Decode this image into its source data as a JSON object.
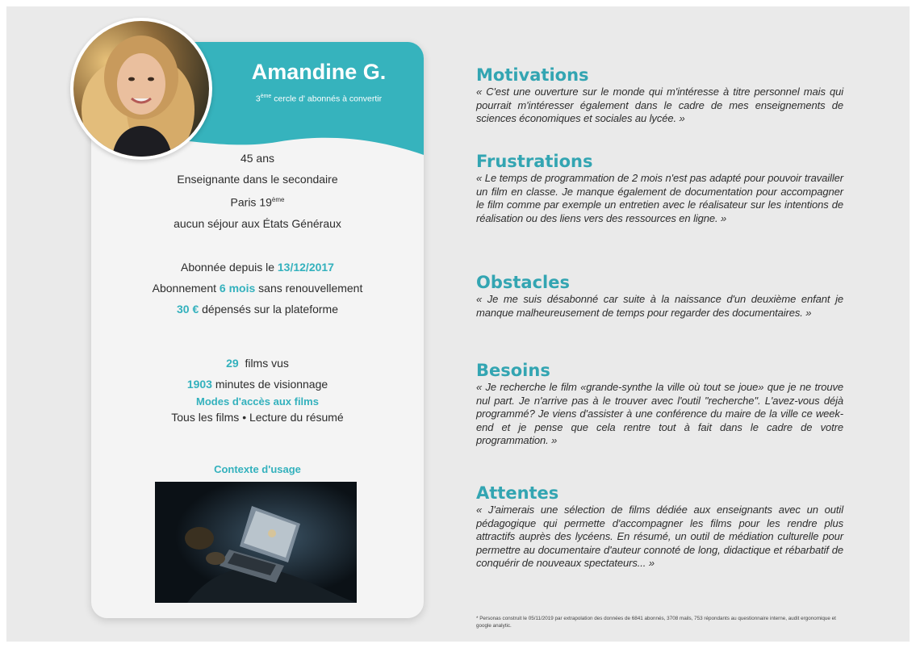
{
  "persona": {
    "name": "Amandine G.",
    "subtitle_sup": "ème",
    "subtitle_prefix": "3",
    "subtitle_rest": " cercle d' abonnés à convertir",
    "age": "45 ans",
    "job": "Enseignante dans le secondaire",
    "city_prefix": "Paris 19",
    "city_sup": "ème",
    "visits": "aucun séjour aux États Généraux",
    "subscribed_prefix": "Abonnée depuis le ",
    "subscribed_date": "13/12/2017",
    "plan_prefix": "Abonnement ",
    "plan_duration": "6 mois",
    "plan_suffix": " sans renouvellement",
    "spent_amount": "30 €",
    "spent_suffix": " dépensés sur la plateforme",
    "films_count": "29",
    "films_suffix": "  films vus",
    "minutes_count": "1903",
    "minutes_suffix": " minutes de visionnage",
    "access_title": "Modes d'accès aux films",
    "access_item_1": "Tous les films",
    "access_separator": "•",
    "access_item_2": "Lecture du résumé",
    "context_title": "Contexte d'usage",
    "accent_color": "#33b1bd"
  },
  "sections": {
    "motivations": {
      "title": "Motivations",
      "text": "« C'est une ouverture sur le monde qui m'intéresse à titre personnel mais qui pourrait m'intéresser également dans le cadre de mes enseignements de sciences économiques et sociales au lycée. »"
    },
    "frustrations": {
      "title": "Frustrations",
      "text": "« Le temps de programmation de 2 mois n'est pas adapté pour pouvoir travailler un film en classe. Je manque également de documentation pour accompagner le film comme par exemple un entretien avec le réalisateur sur les intentions de réalisation ou des liens vers des ressources en ligne. »"
    },
    "obstacles": {
      "title": "Obstacles",
      "text": "« Je me suis désabonné car suite à la naissance d'un deuxième enfant je manque malheureusement de temps pour regarder des documentaires. »"
    },
    "besoins": {
      "title": "Besoins",
      "text": "« Je recherche le film «grande-synthe la ville où tout se joue» que je ne trouve nul part. Je n'arrive pas à le trouver avec l'outil \"recherche\". L'avez-vous déjà programmé? Je viens d'assister à une conférence du maire de la ville ce week-end et je pense que cela rentre tout à fait dans le cadre de votre programmation. »"
    },
    "attentes": {
      "title": "Attentes",
      "text": "« J'aimerais une sélection de films dédiée aux enseignants avec un outil pédagogique qui permette d'accompagner les films pour les rendre plus attractifs auprès des lycéens. En résumé, un outil de médiation culturelle pour permettre au documentaire d'auteur connoté de long, didactique et rébarbatif de conquérir de nouveaux spectateurs... »"
    }
  },
  "footnote": "* Personas construit le 05/11/2019 par extrapolation des données de 6841 abonnés, 3708 mails, 753 répondants au questionnaire interne, audit ergonomique et google analytic.",
  "colors": {
    "heading": "#33a5b2",
    "banner": "#36b3bd",
    "background": "#eaeaea"
  }
}
